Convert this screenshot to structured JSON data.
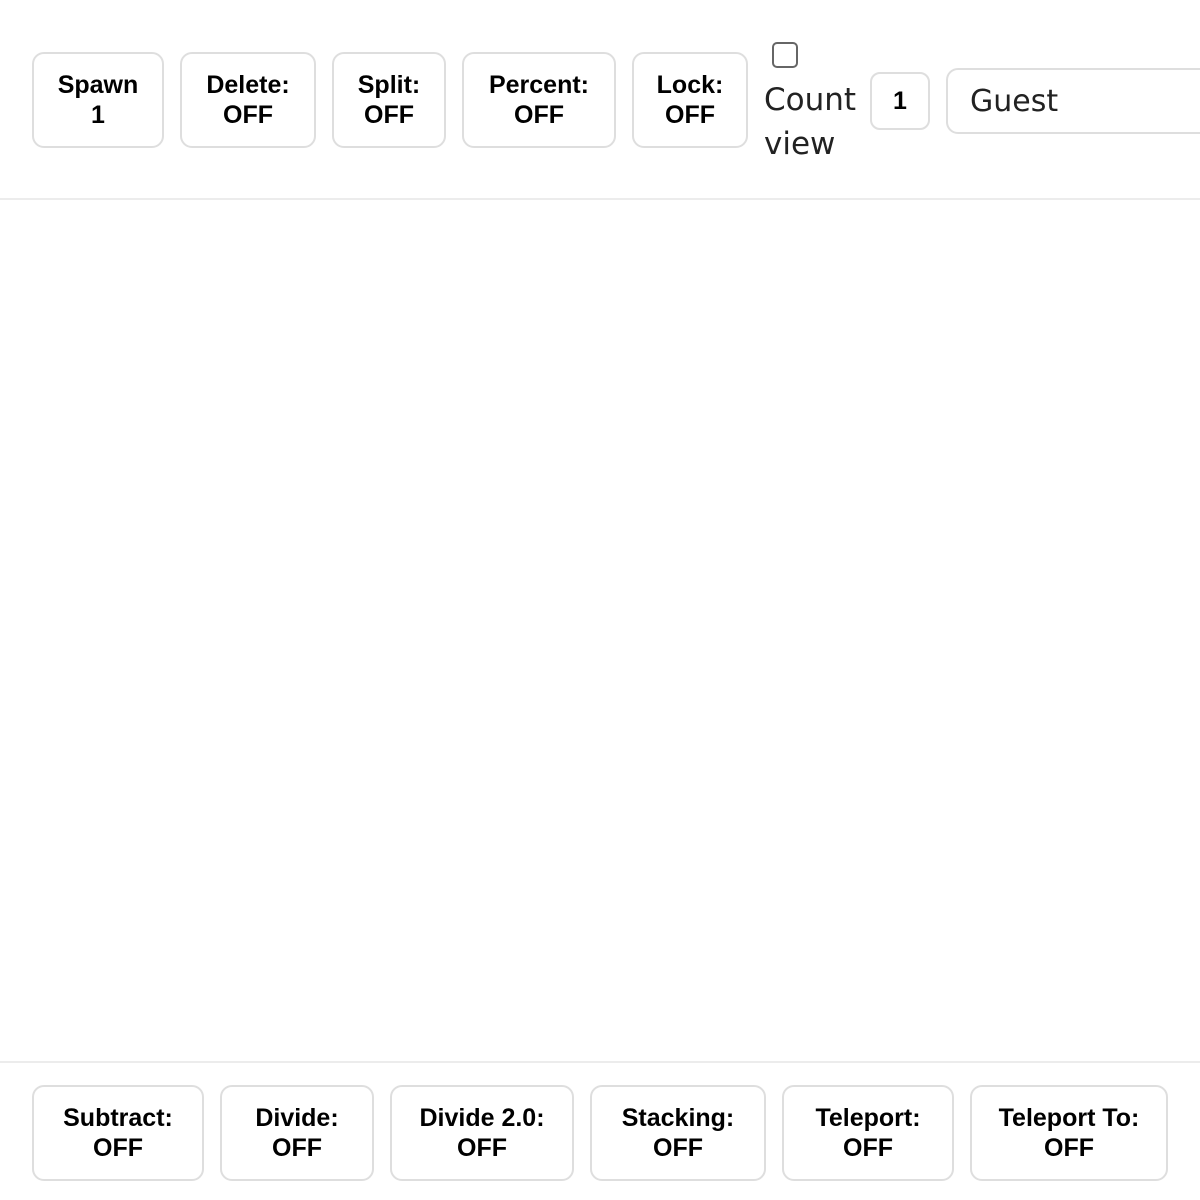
{
  "top_toolbar": {
    "spawn": {
      "label": "Spawn",
      "value": "1"
    },
    "delete": {
      "label": "Delete:",
      "value": "OFF"
    },
    "split": {
      "label": "Split:",
      "value": "OFF"
    },
    "percent": {
      "label": "Percent:",
      "value": "OFF"
    },
    "lock": {
      "label": "Lock:",
      "value": "OFF"
    },
    "count_view": {
      "label": "Count view",
      "checked": false
    },
    "count_value": "1",
    "name_value": "Guest"
  },
  "bottom_toolbar": {
    "subtract": {
      "label": "Subtract:",
      "value": "OFF"
    },
    "divide": {
      "label": "Divide:",
      "value": "OFF"
    },
    "divide2": {
      "label": "Divide 2.0:",
      "value": "OFF"
    },
    "stacking": {
      "label": "Stacking:",
      "value": "OFF"
    },
    "teleport": {
      "label": "Teleport:",
      "value": "OFF"
    },
    "teleport_to": {
      "label": "Teleport To:",
      "value": "OFF"
    }
  }
}
